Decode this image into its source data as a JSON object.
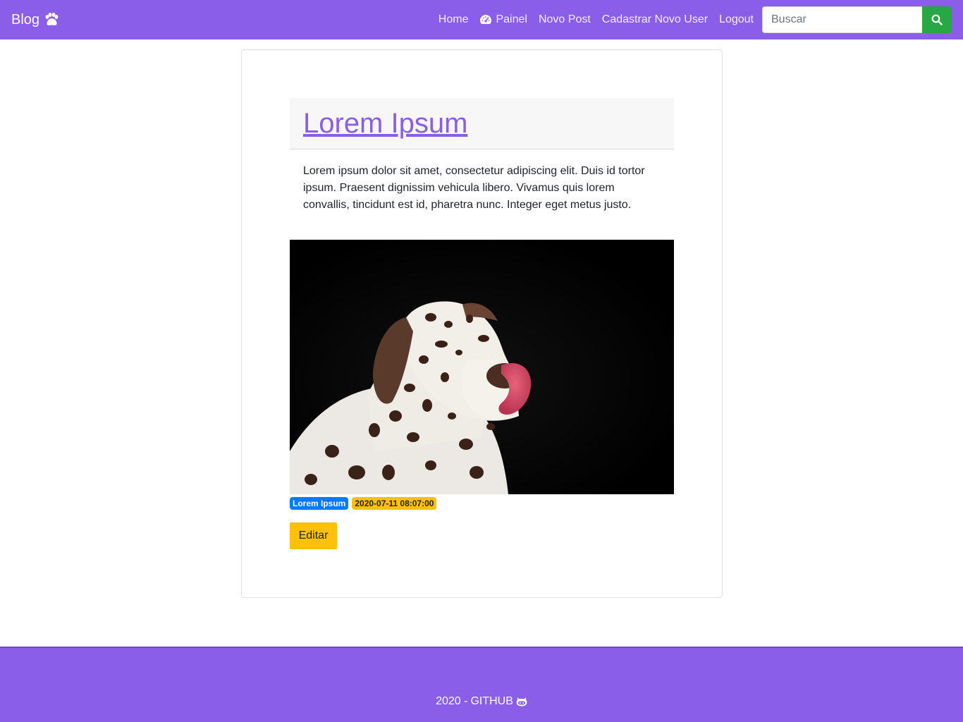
{
  "navbar": {
    "brand": "Blog",
    "brand_icon": "paw-icon",
    "links": {
      "home": "Home",
      "painel": "Painel",
      "novo_post": "Novo Post",
      "cadastrar": "Cadastrar Novo User",
      "logout": "Logout"
    },
    "painel_icon": "tachometer-icon",
    "search": {
      "placeholder": "Buscar",
      "value": "",
      "icon": "search-icon"
    }
  },
  "post": {
    "title": "Lorem Ipsum",
    "body": "Lorem ipsum dolor sit amet, consectetur adipiscing elit. Duis id tortor ipsum. Praesent dignissim vehicula libero. Vivamus quis lorem convallis, tincidunt est id, pharetra nunc. Integer eget metus justo.",
    "image_alt": "Dalmatian dog licking its nose on black background",
    "category_badge": "Lorem Ipsum",
    "date_badge": "2020-07-11 08:07:00",
    "edit_label": "Editar"
  },
  "footer": {
    "year_text": "2020 -",
    "link_text": "GITHUB",
    "icon": "github-icon"
  },
  "colors": {
    "primary": "#8a5ee8",
    "success": "#28a745",
    "badge_primary": "#007bff",
    "warning": "#ffc107"
  }
}
